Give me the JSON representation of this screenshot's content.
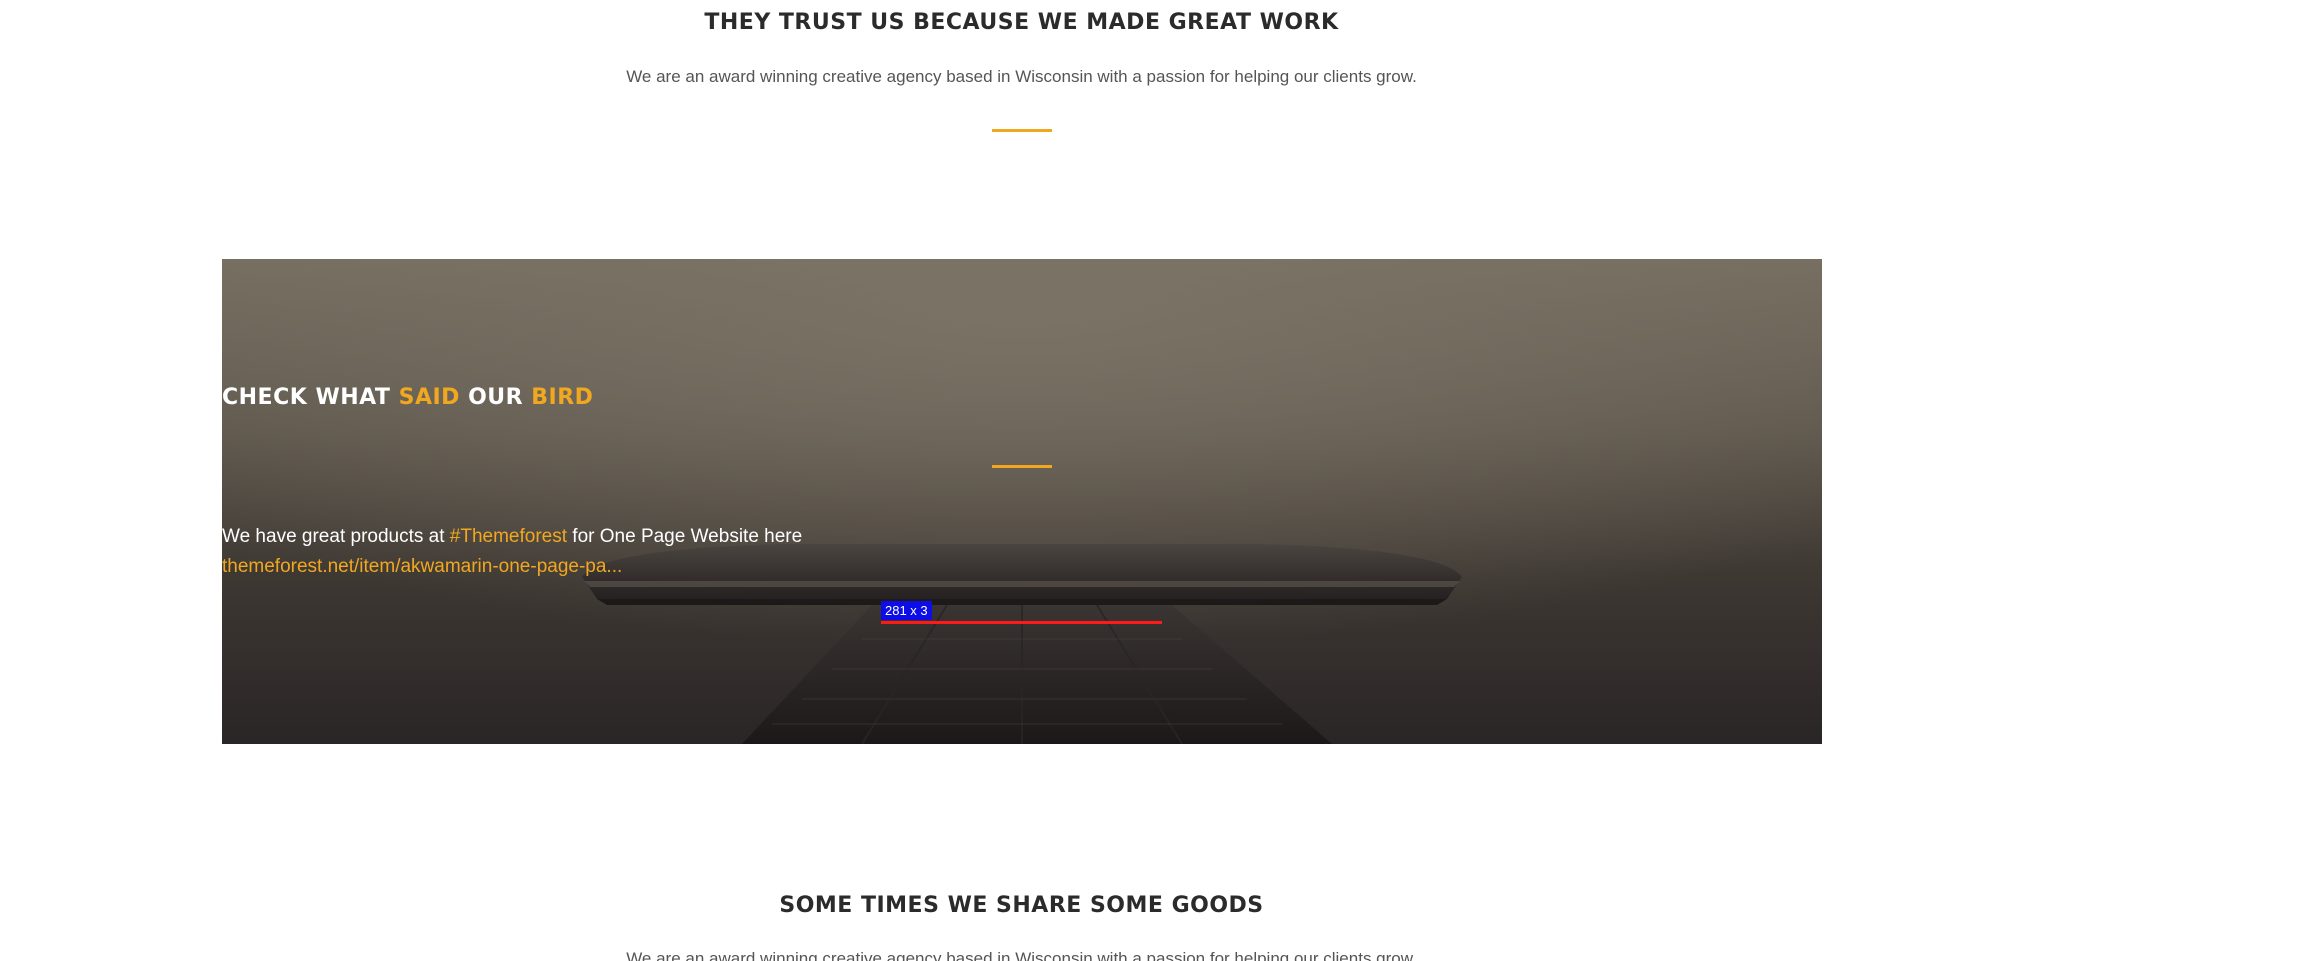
{
  "trust_section": {
    "title": "THEY TRUST US BECAUSE WE MADE GREAT WORK",
    "subtitle": "We are an award winning creative agency based in Wisconsin with a passion for helping our clients grow."
  },
  "twitter_section": {
    "title_parts": [
      "CHECK WHAT ",
      "SAID",
      " OUR ",
      "BIRD"
    ],
    "tweet_text": "We have great products at ",
    "tweet_hashtag": "#Themeforest",
    "tweet_text_after": " for One Page Website here",
    "tweet_link": "themeforest.net/item/akwamarin-one-page-pa...",
    "measure_label": "281 x 3"
  },
  "goods_section": {
    "title": "SOME TIMES WE SHARE SOME GOODS",
    "subtitle": "We are an award winning creative agency based in Wisconsin with a passion for helping our clients grow."
  },
  "colors": {
    "accent": "#f1a820",
    "heading": "#2b2b2b",
    "text": "#555555",
    "measure_badge": "#0d0de8",
    "measure_line": "#ff1a1a"
  }
}
